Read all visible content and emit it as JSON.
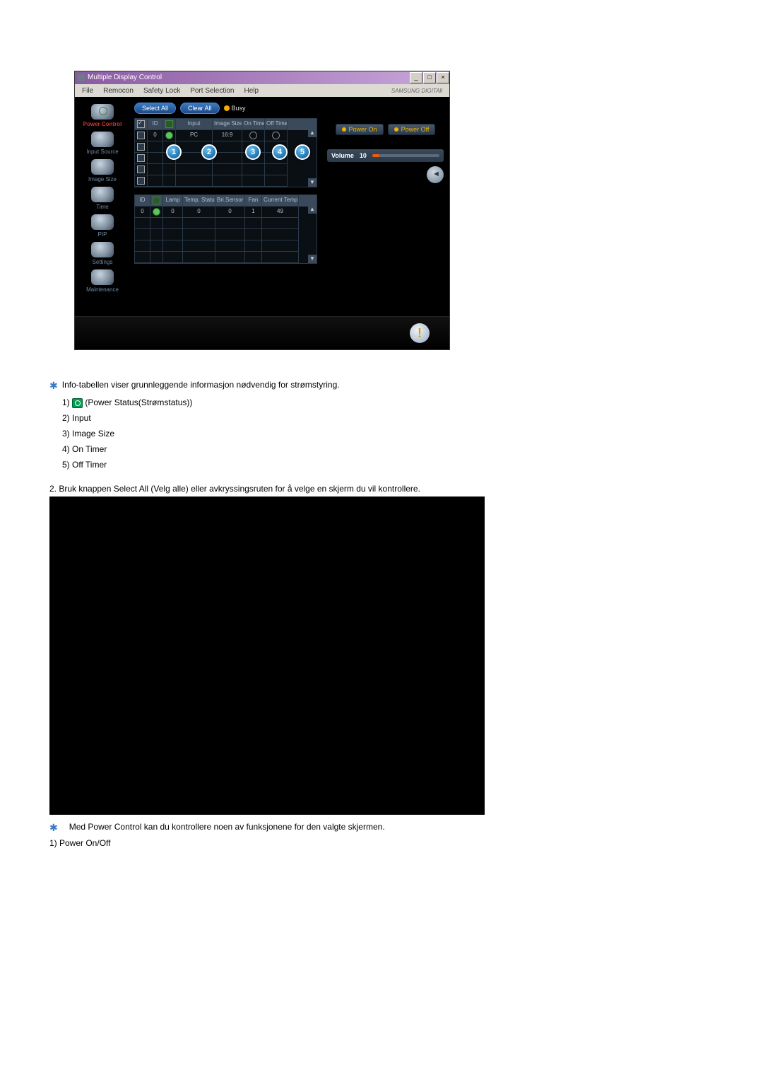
{
  "window": {
    "title": "Multiple Display Control",
    "brand": "SAMSUNG DIGITAll"
  },
  "menubar": {
    "items": [
      "File",
      "Remocon",
      "Safety Lock",
      "Port Selection",
      "Help"
    ]
  },
  "sidebar": {
    "items": [
      {
        "label": "Power Control",
        "active": true
      },
      {
        "label": "Input Source"
      },
      {
        "label": "Image Size"
      },
      {
        "label": "Time"
      },
      {
        "label": "PIP"
      },
      {
        "label": "Settings"
      },
      {
        "label": "Maintenance"
      }
    ]
  },
  "toolbar": {
    "select_all": "Select All",
    "clear_all": "Clear All",
    "busy": "Busy"
  },
  "grid1": {
    "headers": {
      "id": "ID",
      "input": "Input",
      "image_size": "Image Size",
      "on_timer": "On Timer",
      "off_timer": "Off Timer"
    },
    "rows": [
      {
        "checked": true,
        "id": "0",
        "status": "on",
        "input": "PC",
        "image_size": "16:9",
        "on_timer": "○",
        "off_timer": "○"
      }
    ],
    "empty_rows": 4
  },
  "grid2": {
    "headers": {
      "id": "ID",
      "lamp": "Lamp",
      "temp_status": "Temp. Status",
      "bri_sensor": "Bri.Sensor",
      "fan": "Fan",
      "current_temp": "Current Temp."
    },
    "rows": [
      {
        "id": "0",
        "status": "on",
        "lamp": "0",
        "temp_status": "0",
        "bri_sensor": "0",
        "fan": "1",
        "current_temp": "49"
      }
    ],
    "empty_rows": 4
  },
  "badges": [
    "1",
    "2",
    "3",
    "4",
    "5"
  ],
  "right": {
    "power_on": "Power On",
    "power_off": "Power Off",
    "volume_label": "Volume",
    "volume_value": "10"
  },
  "doc": {
    "p1": "Info-tabellen viser grunnleggende informasjon nødvendig for strømstyring.",
    "list1": {
      "i1_prefix": "1)",
      "i1_text": " (Power Status(Strømstatus))",
      "i2": "2) Input",
      "i3": "3) Image Size",
      "i4": "4) On Timer",
      "i5": "5) Off Timer"
    },
    "p2": "2.  Bruk knappen Select All (Velg alle) eller avkryssingsruten for å velge en skjerm du vil kontrollere.",
    "p3": "Med Power Control kan du kontrollere noen av funksjonene for den valgte skjermen.",
    "p4": "1)  Power On/Off"
  }
}
